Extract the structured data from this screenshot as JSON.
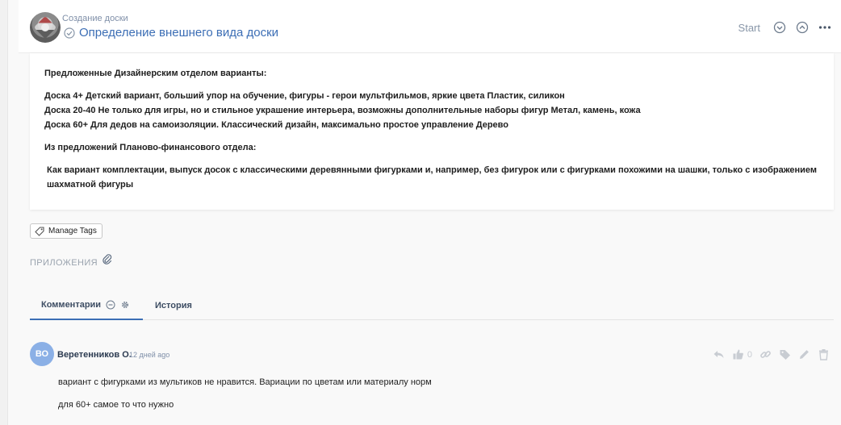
{
  "header": {
    "breadcrumb": "Создание доски",
    "title": "Определение внешнего вида доски",
    "start_label": "Start"
  },
  "content": {
    "heading1": "Предложенные Дизайнерским отделом варианты:",
    "lines": [
      "Доска 4+ Детский вариант, больший упор на обучение, фигуры - герои мультфильмов, яркие цвета Пластик, силикон",
      "Доска 20-40 Не только для игры, но и стильное украшение интерьера, возможны дополнительные наборы фигур Метал, камень, кожа",
      "Доска 60+ Для дедов на самоизоляции. Классический дизайн, максимально простое управление Дерево"
    ],
    "heading2": "Из предложений Планово-финансового отдела:",
    "paragraph": "Как вариант комплектации, выпуск досок с классическими деревянными фигурками и, например, без фигурок или с фигурками похожими на шашки, только с изображением шахматной фигуры"
  },
  "tags": {
    "label": "Manage Tags"
  },
  "attachments": {
    "label": "ПРИЛОЖЕНИЯ"
  },
  "tabs": {
    "comments": "Комментарии",
    "history": "История"
  },
  "comment": {
    "avatar_initials": "ВО",
    "author": "Веретенников О.",
    "time": "12 дней ago",
    "likes": "0",
    "lines": [
      "вариант с фигурками из мультиков не нравится. Вариации по цветам или материалу норм",
      "для 60+ самое то что нужно"
    ]
  },
  "colors": {
    "accent": "#3c6eb5",
    "avatar": "#8bb0e6",
    "muted": "#7f8fa8"
  }
}
